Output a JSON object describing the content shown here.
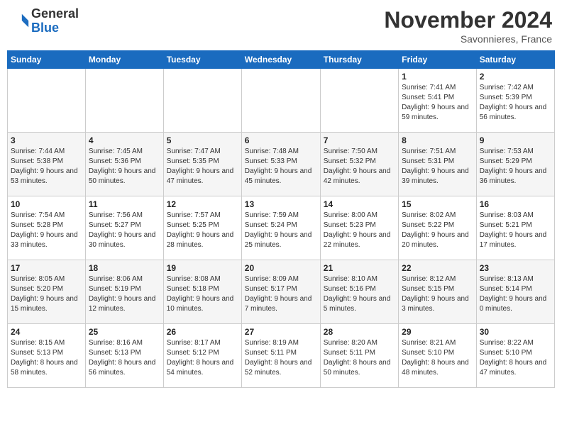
{
  "logo": {
    "general": "General",
    "blue": "Blue"
  },
  "title": "November 2024",
  "location": "Savonnieres, France",
  "days_header": [
    "Sunday",
    "Monday",
    "Tuesday",
    "Wednesday",
    "Thursday",
    "Friday",
    "Saturday"
  ],
  "weeks": [
    [
      {
        "day": "",
        "info": ""
      },
      {
        "day": "",
        "info": ""
      },
      {
        "day": "",
        "info": ""
      },
      {
        "day": "",
        "info": ""
      },
      {
        "day": "",
        "info": ""
      },
      {
        "day": "1",
        "info": "Sunrise: 7:41 AM\nSunset: 5:41 PM\nDaylight: 9 hours and 59 minutes."
      },
      {
        "day": "2",
        "info": "Sunrise: 7:42 AM\nSunset: 5:39 PM\nDaylight: 9 hours and 56 minutes."
      }
    ],
    [
      {
        "day": "3",
        "info": "Sunrise: 7:44 AM\nSunset: 5:38 PM\nDaylight: 9 hours and 53 minutes."
      },
      {
        "day": "4",
        "info": "Sunrise: 7:45 AM\nSunset: 5:36 PM\nDaylight: 9 hours and 50 minutes."
      },
      {
        "day": "5",
        "info": "Sunrise: 7:47 AM\nSunset: 5:35 PM\nDaylight: 9 hours and 47 minutes."
      },
      {
        "day": "6",
        "info": "Sunrise: 7:48 AM\nSunset: 5:33 PM\nDaylight: 9 hours and 45 minutes."
      },
      {
        "day": "7",
        "info": "Sunrise: 7:50 AM\nSunset: 5:32 PM\nDaylight: 9 hours and 42 minutes."
      },
      {
        "day": "8",
        "info": "Sunrise: 7:51 AM\nSunset: 5:31 PM\nDaylight: 9 hours and 39 minutes."
      },
      {
        "day": "9",
        "info": "Sunrise: 7:53 AM\nSunset: 5:29 PM\nDaylight: 9 hours and 36 minutes."
      }
    ],
    [
      {
        "day": "10",
        "info": "Sunrise: 7:54 AM\nSunset: 5:28 PM\nDaylight: 9 hours and 33 minutes."
      },
      {
        "day": "11",
        "info": "Sunrise: 7:56 AM\nSunset: 5:27 PM\nDaylight: 9 hours and 30 minutes."
      },
      {
        "day": "12",
        "info": "Sunrise: 7:57 AM\nSunset: 5:25 PM\nDaylight: 9 hours and 28 minutes."
      },
      {
        "day": "13",
        "info": "Sunrise: 7:59 AM\nSunset: 5:24 PM\nDaylight: 9 hours and 25 minutes."
      },
      {
        "day": "14",
        "info": "Sunrise: 8:00 AM\nSunset: 5:23 PM\nDaylight: 9 hours and 22 minutes."
      },
      {
        "day": "15",
        "info": "Sunrise: 8:02 AM\nSunset: 5:22 PM\nDaylight: 9 hours and 20 minutes."
      },
      {
        "day": "16",
        "info": "Sunrise: 8:03 AM\nSunset: 5:21 PM\nDaylight: 9 hours and 17 minutes."
      }
    ],
    [
      {
        "day": "17",
        "info": "Sunrise: 8:05 AM\nSunset: 5:20 PM\nDaylight: 9 hours and 15 minutes."
      },
      {
        "day": "18",
        "info": "Sunrise: 8:06 AM\nSunset: 5:19 PM\nDaylight: 9 hours and 12 minutes."
      },
      {
        "day": "19",
        "info": "Sunrise: 8:08 AM\nSunset: 5:18 PM\nDaylight: 9 hours and 10 minutes."
      },
      {
        "day": "20",
        "info": "Sunrise: 8:09 AM\nSunset: 5:17 PM\nDaylight: 9 hours and 7 minutes."
      },
      {
        "day": "21",
        "info": "Sunrise: 8:10 AM\nSunset: 5:16 PM\nDaylight: 9 hours and 5 minutes."
      },
      {
        "day": "22",
        "info": "Sunrise: 8:12 AM\nSunset: 5:15 PM\nDaylight: 9 hours and 3 minutes."
      },
      {
        "day": "23",
        "info": "Sunrise: 8:13 AM\nSunset: 5:14 PM\nDaylight: 9 hours and 0 minutes."
      }
    ],
    [
      {
        "day": "24",
        "info": "Sunrise: 8:15 AM\nSunset: 5:13 PM\nDaylight: 8 hours and 58 minutes."
      },
      {
        "day": "25",
        "info": "Sunrise: 8:16 AM\nSunset: 5:13 PM\nDaylight: 8 hours and 56 minutes."
      },
      {
        "day": "26",
        "info": "Sunrise: 8:17 AM\nSunset: 5:12 PM\nDaylight: 8 hours and 54 minutes."
      },
      {
        "day": "27",
        "info": "Sunrise: 8:19 AM\nSunset: 5:11 PM\nDaylight: 8 hours and 52 minutes."
      },
      {
        "day": "28",
        "info": "Sunrise: 8:20 AM\nSunset: 5:11 PM\nDaylight: 8 hours and 50 minutes."
      },
      {
        "day": "29",
        "info": "Sunrise: 8:21 AM\nSunset: 5:10 PM\nDaylight: 8 hours and 48 minutes."
      },
      {
        "day": "30",
        "info": "Sunrise: 8:22 AM\nSunset: 5:10 PM\nDaylight: 8 hours and 47 minutes."
      }
    ]
  ]
}
